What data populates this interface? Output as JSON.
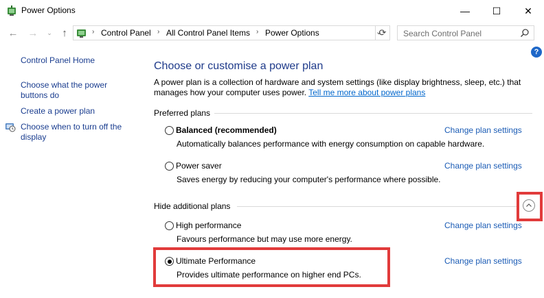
{
  "window": {
    "title": "Power Options",
    "controls": {
      "minimize": "—",
      "maximize": "☐",
      "close": "✕"
    }
  },
  "nav": {
    "back": "←",
    "forward": "→",
    "recent": "⌄",
    "up": "↑",
    "breadcrumbs": [
      "Control Panel",
      "All Control Panel Items",
      "Power Options"
    ],
    "separator": "›",
    "dropdown": "⌄",
    "refresh": "⟳",
    "search_placeholder": "Search Control Panel"
  },
  "help": {
    "label": "?"
  },
  "sidebar": {
    "items": [
      {
        "label": "Control Panel Home"
      },
      {
        "label": "Choose what the power buttons do"
      },
      {
        "label": "Create a power plan"
      },
      {
        "label": "Choose when to turn off the display",
        "icon": "monitor-clock-icon"
      }
    ]
  },
  "main": {
    "title": "Choose or customise a power plan",
    "intro_text": "A power plan is a collection of hardware and system settings (like display brightness, sleep, etc.) that manages how your computer uses power.",
    "intro_link": "Tell me more about power plans",
    "preferred_heading": "Preferred plans",
    "additional_heading": "Hide additional plans",
    "change_label": "Change plan settings",
    "plans": [
      {
        "name": "Balanced (recommended)",
        "desc": "Automatically balances performance with energy consumption on capable hardware.",
        "selected": false
      },
      {
        "name": "Power saver",
        "desc": "Saves energy by reducing your computer's performance where possible.",
        "selected": false
      },
      {
        "name": "High performance",
        "desc": "Favours performance but may use more energy.",
        "selected": false
      },
      {
        "name": "Ultimate Performance",
        "desc": "Provides ultimate performance on higher end PCs.",
        "selected": true
      }
    ]
  },
  "colors": {
    "link": "#1a5bb5",
    "title": "#1e3a8a",
    "highlight": "#e13b3b"
  }
}
